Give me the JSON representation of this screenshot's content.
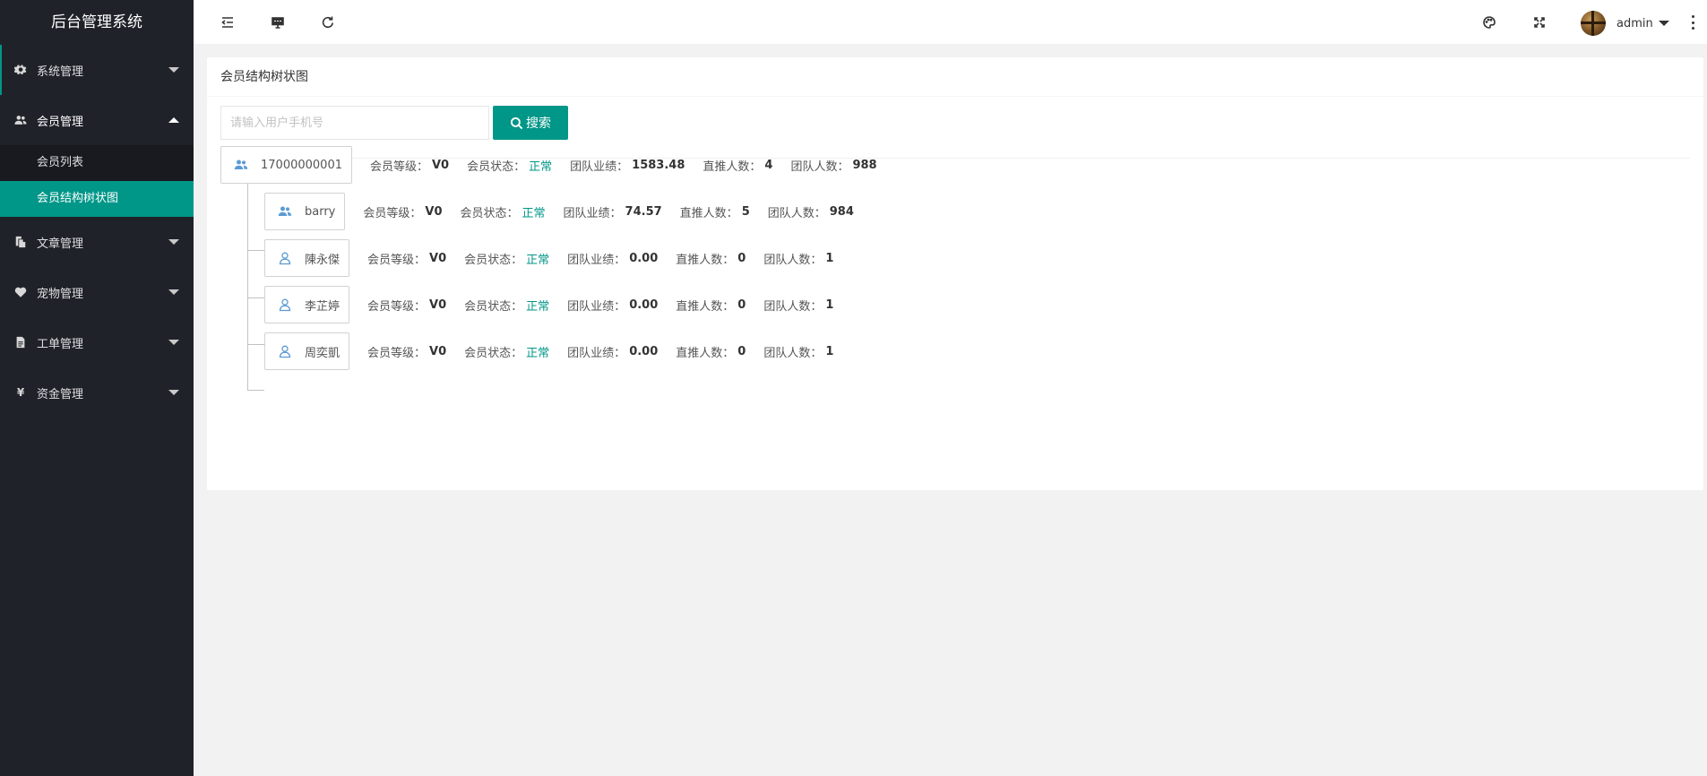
{
  "app": {
    "title": "后台管理系统"
  },
  "sidebar": {
    "items": [
      {
        "label": "系统管理",
        "icon": "gear-icon",
        "expanded": false
      },
      {
        "label": "会员管理",
        "icon": "users-icon",
        "expanded": true,
        "children": [
          {
            "label": "会员列表",
            "active": false
          },
          {
            "label": "会员结构树状图",
            "active": true
          }
        ]
      },
      {
        "label": "文章管理",
        "icon": "copy-icon",
        "expanded": false
      },
      {
        "label": "宠物管理",
        "icon": "heart-icon",
        "expanded": false
      },
      {
        "label": "工单管理",
        "icon": "file-icon",
        "expanded": false
      },
      {
        "label": "资金管理",
        "icon": "yen-icon",
        "expanded": false
      }
    ]
  },
  "header": {
    "icons": [
      "indent-icon",
      "monitor-icon",
      "refresh-icon",
      "theme-icon",
      "fullscreen-icon",
      "more-icon"
    ],
    "user": {
      "name": "admin"
    }
  },
  "main": {
    "card_title": "会员结构树状图",
    "search": {
      "placeholder": "请输入用户手机号",
      "value": "",
      "button_label": "搜索"
    },
    "labels": {
      "level": "会员等级：",
      "status": "会员状态：",
      "performance": "团队业绩：",
      "direct": "直推人数：",
      "team": "团队人数："
    },
    "tree": [
      {
        "name": "17000000001",
        "icon": "users-icon",
        "depth": 0,
        "level": "V0",
        "status": "正常",
        "performance": "1583.48",
        "direct": "4",
        "team": "988"
      },
      {
        "name": "barry",
        "icon": "users-icon",
        "depth": 1,
        "level": "V0",
        "status": "正常",
        "performance": "74.57",
        "direct": "5",
        "team": "984"
      },
      {
        "name": "陳永傑",
        "icon": "user-icon",
        "depth": 1,
        "level": "V0",
        "status": "正常",
        "performance": "0.00",
        "direct": "0",
        "team": "1"
      },
      {
        "name": "李芷婷",
        "icon": "user-icon",
        "depth": 1,
        "level": "V0",
        "status": "正常",
        "performance": "0.00",
        "direct": "0",
        "team": "1"
      },
      {
        "name": "周奕凱",
        "icon": "user-icon",
        "depth": 1,
        "level": "V0",
        "status": "正常",
        "performance": "0.00",
        "direct": "0",
        "team": "1"
      }
    ]
  },
  "colors": {
    "accent": "#009688",
    "sidebar_bg": "#20222a",
    "status_ok": "#009688",
    "icon_blue": "#5b9bd5"
  }
}
